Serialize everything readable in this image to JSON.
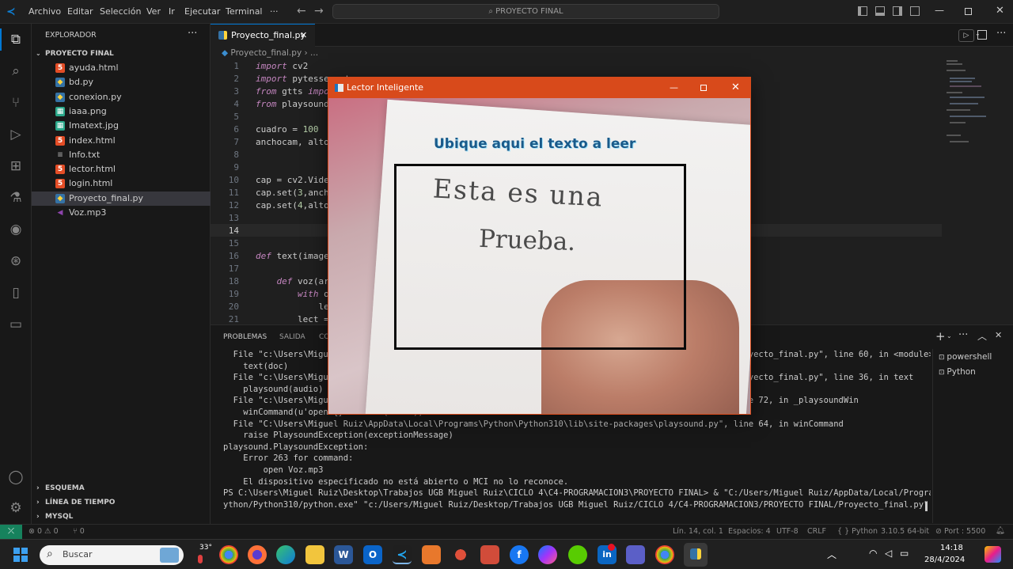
{
  "menu": {
    "items": [
      "Archivo",
      "Editar",
      "Selección",
      "Ver",
      "Ir",
      "Ejecutar",
      "Terminal",
      "···"
    ],
    "search": "PROYECTO FINAL"
  },
  "explorer": {
    "title": "EXPLORADOR",
    "folder": "PROYECTO FINAL",
    "files": [
      {
        "name": "ayuda.html",
        "type": "html"
      },
      {
        "name": "bd.py",
        "type": "python"
      },
      {
        "name": "conexion.py",
        "type": "python"
      },
      {
        "name": "iaaa.png",
        "type": "image"
      },
      {
        "name": "Imatext.jpg",
        "type": "image"
      },
      {
        "name": "index.html",
        "type": "html"
      },
      {
        "name": "Info.txt",
        "type": "text"
      },
      {
        "name": "lector.html",
        "type": "html"
      },
      {
        "name": "login.html",
        "type": "html"
      },
      {
        "name": "Proyecto_final.py",
        "type": "python"
      },
      {
        "name": "Voz.mp3",
        "type": "audio"
      }
    ],
    "sections": [
      "ESQUEMA",
      "LÍNEA DE TIEMPO",
      "MYSQL"
    ]
  },
  "editor": {
    "tab": "Proyecto_final.py",
    "breadcrumb": "Proyecto_final.py › ...",
    "lines": [
      {
        "n": "1",
        "code": "import cv2"
      },
      {
        "n": "2",
        "code": "import pytesseract"
      },
      {
        "n": "3",
        "code": "from gtts import gTTS"
      },
      {
        "n": "4",
        "code": "from playsound import playsound"
      },
      {
        "n": "5",
        "code": ""
      },
      {
        "n": "6",
        "code": "cuadro = 100"
      },
      {
        "n": "7",
        "code": "anchocam, altocam = 640, 480"
      },
      {
        "n": "8",
        "code": ""
      },
      {
        "n": "9",
        "code": ""
      },
      {
        "n": "10",
        "code": "cap = cv2.VideoCapture(0)"
      },
      {
        "n": "11",
        "code": "cap.set(3,anchocam)"
      },
      {
        "n": "12",
        "code": "cap.set(4,altocam)"
      },
      {
        "n": "13",
        "code": ""
      },
      {
        "n": "14",
        "code": ""
      },
      {
        "n": "15",
        "code": ""
      },
      {
        "n": "16",
        "code": "def text(image):"
      },
      {
        "n": "17",
        "code": ""
      },
      {
        "n": "18",
        "code": "    def voz(archi_text):"
      },
      {
        "n": "19",
        "code": "        with open(archi_text):"
      },
      {
        "n": "20",
        "code": "            lectura = f.read()"
      },
      {
        "n": "21",
        "code": "        lect = gTTS(text=lectura)"
      }
    ]
  },
  "panel": {
    "tabs": [
      "PROBLEMAS",
      "SALIDA",
      "CONSOLA DE DEPURACIÓN",
      "TERMINAL",
      "PUERTOS"
    ],
    "terminals": [
      "powershell",
      "Python"
    ],
    "lines": [
      "  File \"c:\\Users\\Miguel Ruiz\\Desktop\\Trabajos UGB Miguel Ruiz\\CICLO 4\\C4-PROGRAMACION3\\PROYECTO FINAL\\Proyecto_final.py\", line 60, in <module>",
      "    text(doc)",
      "  File \"c:\\Users\\Miguel Ruiz\\Desktop\\Trabajos UGB Miguel Ruiz\\CICLO 4\\C4-PROGRAMACION3\\PROYECTO FINAL\\Proyecto_final.py\", line 36, in text",
      "    playsound(audio)",
      "  File \"c:\\Users\\Miguel Ruiz\\AppData\\Local\\Programs\\Python\\Python310\\lib\\site-packages\\playsound.py\", line 72, in _playsoundWin",
      "    winCommand(u'open {}'.format(sound))",
      "  File \"C:\\Users\\Miguel Ruiz\\AppData\\Local\\Programs\\Python\\Python310\\lib\\site-packages\\playsound.py\", line 64, in winCommand",
      "    raise PlaysoundException(exceptionMessage)",
      "playsound.PlaysoundException:",
      "    Error 263 for command:",
      "        open Voz.mp3",
      "    El dispositivo especificado no está abierto o MCI no lo reconoce.",
      "PS C:\\Users\\Miguel Ruiz\\Desktop\\Trabajos UGB Miguel Ruiz\\CICLO 4\\C4-PROGRAMACION3\\PROYECTO FINAL> & \"C:/Users/Miguel Ruiz/AppData/Local/Programs/P",
      "ython/Python310/python.exe\" \"c:/Users/Miguel Ruiz/Desktop/Trabajos UGB Miguel Ruiz/CICLO 4/C4-PROGRAMACION3/PROYECTO FINAL/Proyecto_final.py\""
    ]
  },
  "status": {
    "errors": "0",
    "warnings": "0",
    "ports_left": "0",
    "position": "Lín. 14, col. 1",
    "spaces": "Espacios: 4",
    "encoding": "UTF-8",
    "eol": "CRLF",
    "language": "Python",
    "version": "3.10.5 64-bit",
    "port": "Port : 5500"
  },
  "popup": {
    "title": "Lector Inteligente",
    "overlay_text": "Ubique aqui el texto a leer",
    "handwriting_line1": "Esta es una",
    "handwriting_line2": "Prueba."
  },
  "taskbar": {
    "search": "Buscar",
    "weather": "33°",
    "time": "14:18",
    "date": "28/4/2024"
  },
  "colors": {
    "accent": "#0078d4",
    "popup_title": "#d84a1b",
    "overlay_text": "#1a5a8a"
  }
}
